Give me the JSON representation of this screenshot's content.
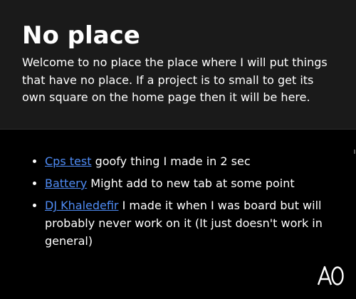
{
  "page": {
    "title": "No place",
    "intro": "Welcome to no place the place where I will put things that have no place. If a project is to small to get its own square on the home page then it will be here."
  },
  "items": [
    {
      "link": "Cps test",
      "description": " goofy thing I made in 2 sec"
    },
    {
      "link": "Battery",
      "description": " Might add to new tab at some point"
    },
    {
      "link": "DJ Khaledefir",
      "description": " I made it when I was board but will probably never work on it (It just doesn't work in general)"
    }
  ],
  "logo": {
    "icon": "a0-logo-icon",
    "text": "A0"
  },
  "colors": {
    "background": "#000000",
    "header_background": "#1a1a1a",
    "text": "#ffffff",
    "link": "#4f8cf5"
  }
}
